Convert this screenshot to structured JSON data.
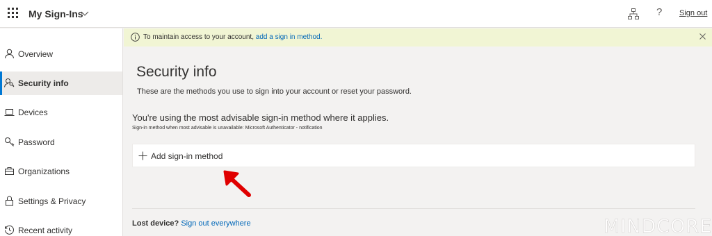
{
  "header": {
    "app_title": "My Sign-Ins",
    "signout_label": "Sign out",
    "help_glyph": "?"
  },
  "sidebar": {
    "items": [
      {
        "label": "Overview",
        "icon": "person-icon",
        "active": false
      },
      {
        "label": "Security info",
        "icon": "person-key-icon",
        "active": true
      },
      {
        "label": "Devices",
        "icon": "laptop-icon",
        "active": false
      },
      {
        "label": "Password",
        "icon": "key-icon",
        "active": false
      },
      {
        "label": "Organizations",
        "icon": "briefcase-icon",
        "active": false
      },
      {
        "label": "Settings & Privacy",
        "icon": "lock-icon",
        "active": false
      },
      {
        "label": "Recent activity",
        "icon": "history-icon",
        "active": false
      }
    ]
  },
  "banner": {
    "text": "To maintain access to your account,",
    "link": "add a sign in method."
  },
  "main": {
    "title": "Security info",
    "subtitle": "These are the methods you use to sign into your account or reset your password.",
    "advisable": "You're using the most advisable sign-in method where it applies.",
    "advisable_note": "Sign-in method when most advisable is unavailable: Microsoft Authenticator - notification",
    "add_method_label": "Add sign-in method",
    "lost_device_question": "Lost device?",
    "lost_device_link": "Sign out everywhere"
  },
  "watermark": "MINDCORE",
  "colors": {
    "accent": "#0078d4",
    "link": "#0067b8",
    "banner_bg": "#f1f5d4",
    "arrow": "#e00000"
  }
}
